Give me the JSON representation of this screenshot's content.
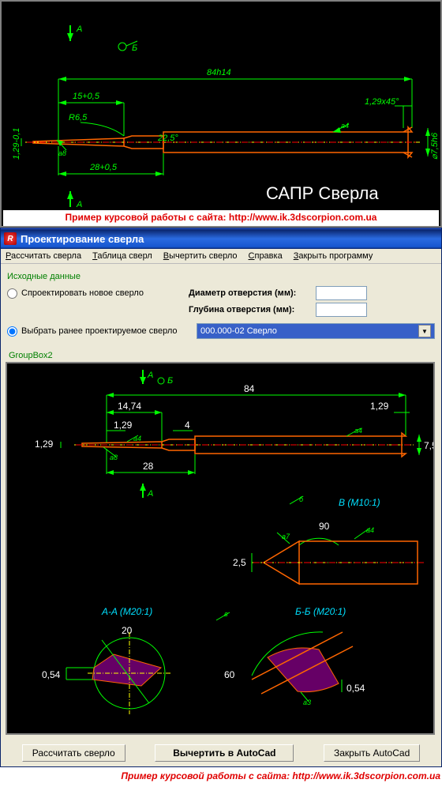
{
  "top_cad": {
    "dims": {
      "overall": "84h14",
      "tip_len": "15+0,5",
      "radius": "R6,5",
      "side": "1,29-0,1",
      "step": "28+0,5",
      "chamfer": "1,29x45°",
      "angle": "22,5°",
      "diameter": "⌀7,5h6"
    },
    "sections": {
      "A_top": "A",
      "A_bot": "A",
      "B": "Б"
    },
    "marks": {
      "a8": "а8",
      "a4": "а4"
    },
    "title": "САПР  Сверла",
    "caption": "Пример курсовой работы с сайта: http://www.ik.3dscorpion.com.ua"
  },
  "app": {
    "title": "Проектирование сверла",
    "menu": {
      "calc": "Рассчитать сверла",
      "table": "Таблица сверл",
      "draw": "Вычертить сверло",
      "help": "Справка",
      "close": "Закрыть программу"
    },
    "form": {
      "heading": "Исходные данные",
      "radio_new": "Спроектировать новое сверло",
      "radio_existing": "Выбрать ранее проектируемое сверло",
      "diam_label": "Диаметр отверстия (мм):",
      "depth_label": "Глубина отверстия (мм):",
      "diam_value": "",
      "depth_value": "",
      "dropdown_value": "000.000-02  Сверло"
    },
    "groupbox_label": "GroupBox2",
    "buttons": {
      "calc": "Рассчитать сверло",
      "draw": "Вычертить в AutoCad",
      "close": "Закрыть AutoCad"
    },
    "footer": "Пример курсовой работы с сайта: http://www.ik.3dscorpion.com.ua"
  },
  "cad2": {
    "sections": {
      "A": "A",
      "B": "Б"
    },
    "dims": {
      "overall": "84",
      "tip": "14,74",
      "tip2": "1,29",
      "step": "28",
      "ch": "1,29",
      "ch2": "4",
      "side": "1,29",
      "dia": "7,5",
      "cone_d": "2,5",
      "angle": "90",
      "sec_a_d": "20",
      "sec_a_h": "0,54",
      "sec_b_ang": "60",
      "sec_b_h": "0,54"
    },
    "views": {
      "B": "В  (M10:1)",
      "AA": "A-A  (M20:1)",
      "BB": "Б-Б  (M20:1)",
      "b_mark": "в",
      "bb_mark": "б"
    },
    "marks": {
      "a4": "а4",
      "a8": "а8",
      "a7": "а7",
      "a3": "а3"
    }
  }
}
